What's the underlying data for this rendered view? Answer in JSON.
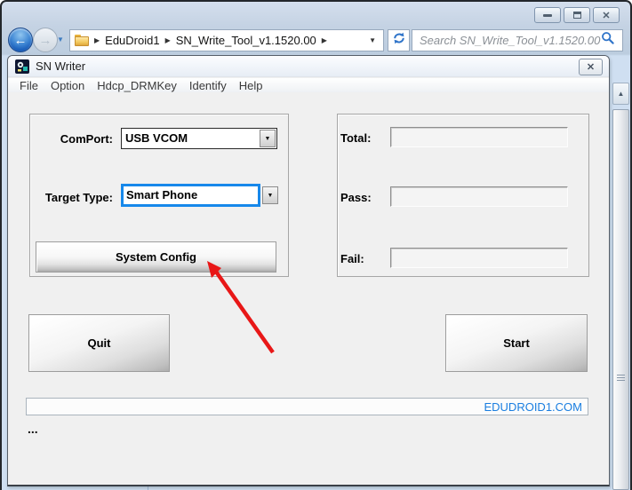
{
  "explorer": {
    "breadcrumb": {
      "items": [
        "EduDroid1",
        "SN_Write_Tool_v1.1520.00"
      ]
    },
    "search_placeholder": "Search SN_Write_Tool_v1.1520.00"
  },
  "app": {
    "title": "SN Writer",
    "menus": [
      "File",
      "Option",
      "Hdcp_DRMKey",
      "Identify",
      "Help"
    ],
    "comport_label": "ComPort:",
    "comport_value": "USB VCOM",
    "target_label": "Target Type:",
    "target_value": "Smart Phone",
    "system_config_label": "System Config",
    "counters": [
      {
        "label": "Total:",
        "value": ""
      },
      {
        "label": "Pass:",
        "value": ""
      },
      {
        "label": "Fail:",
        "value": ""
      }
    ],
    "quit_label": "Quit",
    "start_label": "Start",
    "status_text": "EDUDROID1.COM",
    "log_text": "..."
  },
  "icons": {
    "close": "✕",
    "back_arrow": "←",
    "forward_arrow": "→",
    "caret_down": "▼",
    "caret_up": "▲",
    "chevron_right": "▶"
  },
  "colors": {
    "target_highlight": "#1788ea",
    "status_link_blue": "#1a7ee0",
    "annotation_arrow_red": "#e81717"
  }
}
